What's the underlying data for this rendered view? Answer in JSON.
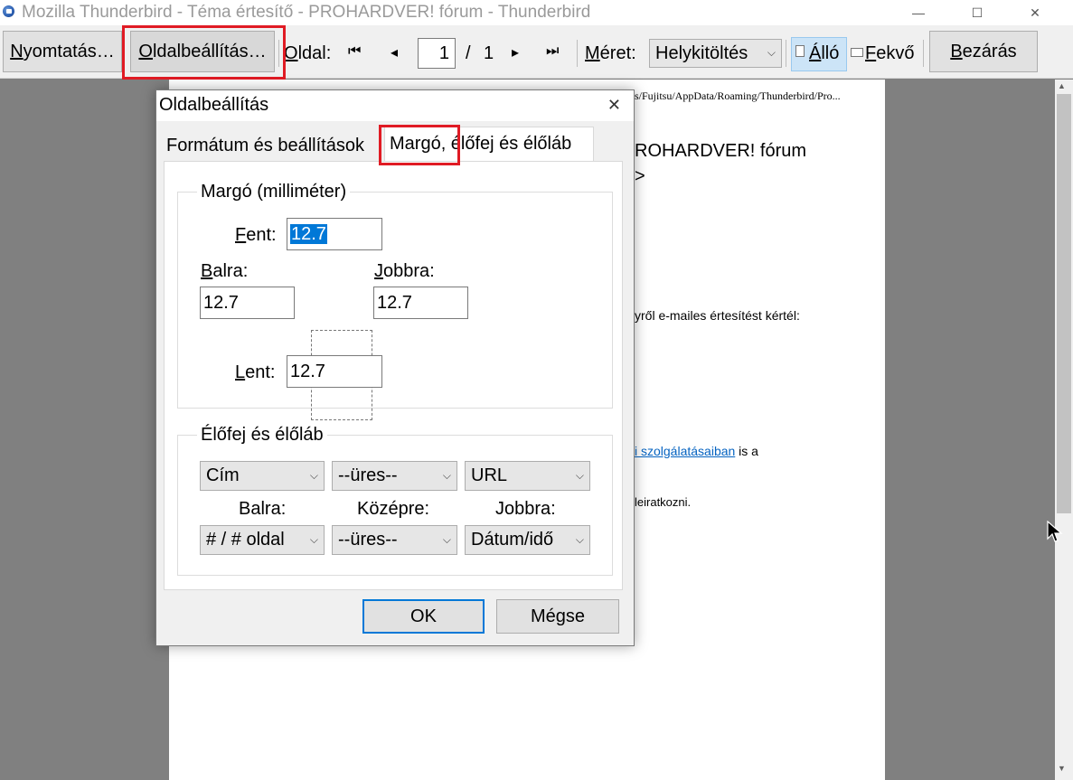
{
  "window": {
    "title": "Mozilla Thunderbird - Téma értesítő - PROHARDVER! fórum - Thunderbird",
    "minimize": "—",
    "maximize": "☐",
    "close": "✕"
  },
  "toolbar": {
    "print_first": "N",
    "print_rest": "yomtatás…",
    "pagesetup_first": "O",
    "pagesetup_rest": "ldalbeállítás…",
    "page_label_first": "O",
    "page_label_rest": "ldal:",
    "first_page": "⏮",
    "prev_page": "◂",
    "page_value": "1",
    "page_sep": "/",
    "page_total": "1",
    "next_page": "▸",
    "last_page": "⏭",
    "size_label_first": "M",
    "size_label_rest": "éret:",
    "size_value": "Helykitöltés",
    "portrait_first": "Á",
    "portrait_rest": "lló",
    "landscape_first": "F",
    "landscape_rest": "ekvő",
    "close_first": "B",
    "close_rest": "ezárás"
  },
  "preview": {
    "path_fragment": "s/Fujitsu/AppData/Roaming/Thunderbird/Pro...",
    "heading_line1": "ROHARDVER! fórum",
    "heading_line2": ">",
    "line1": "yről e-mailes értesítést kértél:",
    "link_text": "i szolgálatásaiban",
    "link_after": " is a",
    "line3": "leiratkozni."
  },
  "dialog": {
    "title": "Oldalbeállítás",
    "close": "✕",
    "tab_format": "Formátum és beállítások",
    "tab_margin": "Margó, élőfej és élőláb",
    "margin_group": "Margó (milliméter)",
    "top_label_first": "F",
    "top_label_rest": "ent:",
    "top_value": "12.7",
    "left_label_first": "B",
    "left_label_rest": "alra:",
    "left_value": "12.7",
    "right_label_first": "J",
    "right_label_rest": "obbra:",
    "right_value": "12.7",
    "bottom_label_first": "L",
    "bottom_label_rest": "ent:",
    "bottom_value": "12.7",
    "hf_group": "Élőfej és élőláb",
    "header_left": "Cím",
    "header_center": "--üres--",
    "header_right": "URL",
    "col_left": "Balra:",
    "col_center": "Középre:",
    "col_right": "Jobbra:",
    "footer_left": "# / # oldal",
    "footer_center": "--üres--",
    "footer_right": "Dátum/idő",
    "ok": "OK",
    "cancel": "Mégse"
  },
  "colors": {
    "highlight": "#e01b24",
    "selection": "#0078d7",
    "link": "#0563c1"
  }
}
